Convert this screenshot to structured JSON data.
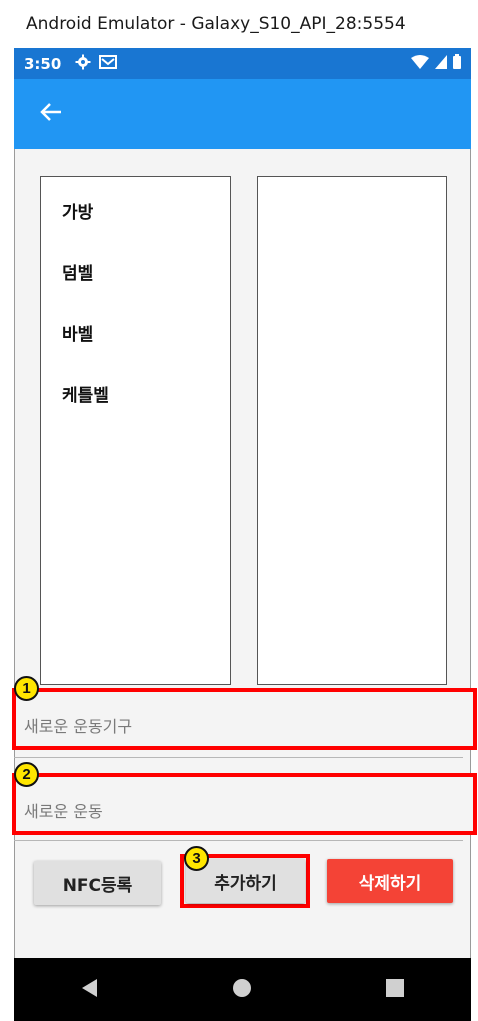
{
  "window": {
    "title": "Android Emulator - Galaxy_S10_API_28:5554"
  },
  "status_bar": {
    "time": "3:50",
    "left_icons": [
      "gear-icon",
      "mail-icon"
    ],
    "right_icons": [
      "wifi-icon",
      "signal-icon",
      "battery-icon"
    ],
    "color": "#1976d2"
  },
  "app_bar": {
    "color": "#2196f3",
    "back_icon": "arrow-left-icon"
  },
  "equipment_list": {
    "items": [
      {
        "label": "가방"
      },
      {
        "label": "덤벨"
      },
      {
        "label": "바벨"
      },
      {
        "label": "케틀벨"
      }
    ]
  },
  "exercise_list": {
    "items": []
  },
  "new_equipment_field": {
    "placeholder": "새로운 운동기구",
    "value": "",
    "badge": "1"
  },
  "new_exercise_field": {
    "placeholder": "새로운 운동",
    "value": "",
    "badge": "2"
  },
  "buttons": {
    "nfc_label": "NFC등록",
    "add_label": "추가하기",
    "add_badge": "3",
    "delete_label": "삭제하기",
    "delete_color": "#f44336"
  },
  "nav_bar": {
    "icons": [
      "back-triangle-icon",
      "home-circle-icon",
      "recents-square-icon"
    ]
  }
}
